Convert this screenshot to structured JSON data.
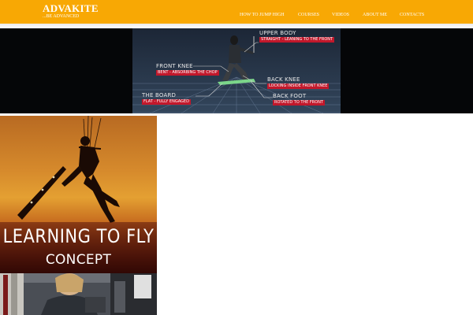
{
  "brand": {
    "logo": "ADVAKITE",
    "tagline": "...BE ADVANCED"
  },
  "nav": {
    "items": [
      {
        "label": "HOW TO JUMP HIGH"
      },
      {
        "label": "COURSES"
      },
      {
        "label": "VIDEOS"
      },
      {
        "label": "ABOUT ME"
      },
      {
        "label": "CONTACTS"
      }
    ]
  },
  "banner": {
    "labels": [
      {
        "title": "UPPER BODY",
        "sub": "STRAIGHT - LEANING TO THE FRONT"
      },
      {
        "title": "FRONT KNEE",
        "sub": "BENT - ABSORBING THE CHOP"
      },
      {
        "title": "BACK KNEE",
        "sub": "LOCKING INSIDE FRONT KNEE"
      },
      {
        "title": "THE BOARD",
        "sub": "FLAT - FULLY ENGAGED"
      },
      {
        "title": "BACK FOOT",
        "sub": "ROTATED TO THE FRONT"
      }
    ]
  },
  "cards": {
    "fly_title": "LEARNING TO FLY",
    "fly_sub": "CONCEPT"
  },
  "colors": {
    "header": "#f8a804",
    "label_red": "#c2182b",
    "banner_bg": "#050608"
  }
}
